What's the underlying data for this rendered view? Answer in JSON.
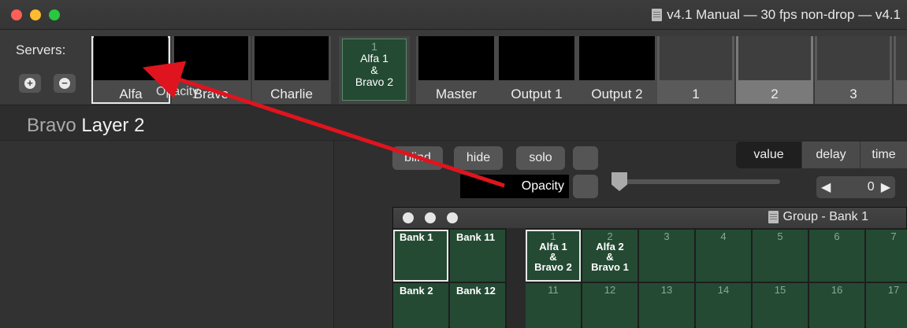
{
  "window": {
    "title": "v4.1 Manual  —  30 fps non-drop  —  v4.1"
  },
  "serverbar": {
    "label": "Servers:",
    "add_glyph": "+",
    "remove_glyph": "−",
    "servers": [
      "Alfa",
      "Bravo",
      "Charlie"
    ],
    "group_tile": {
      "number": "1",
      "line1": "Alfa 1",
      "line2": "&",
      "line3": "Bravo 2"
    },
    "outputs": [
      "Master",
      "Output 1",
      "Output 2"
    ],
    "cues": [
      "1",
      "2",
      "3"
    ],
    "drag_label": "Opacity"
  },
  "layer": {
    "server": "Bravo",
    "name": "Layer 2"
  },
  "controls": {
    "blind": "blind",
    "hide": "hide",
    "solo": "solo",
    "tabs": [
      "value",
      "delay",
      "time"
    ],
    "parameter": "Opacity",
    "stepper_value": "0"
  },
  "group_window": {
    "title": "Group - Bank 1",
    "banks": [
      "Bank 1",
      "Bank 11",
      "Bank 2",
      "Bank 12"
    ],
    "cells_row1": [
      {
        "n": "1",
        "l1": "Alfa 1",
        "l2": "&",
        "l3": "Bravo 2"
      },
      {
        "n": "2",
        "l1": "Alfa 2",
        "l2": "&",
        "l3": "Bravo 1"
      },
      {
        "n": "3"
      },
      {
        "n": "4"
      },
      {
        "n": "5"
      },
      {
        "n": "6"
      },
      {
        "n": "7"
      }
    ],
    "cells_row2": [
      "11",
      "12",
      "13",
      "14",
      "15",
      "16",
      "17"
    ]
  },
  "colors": {
    "accent_green": "#244a33",
    "arrow_red": "#e0141e"
  }
}
